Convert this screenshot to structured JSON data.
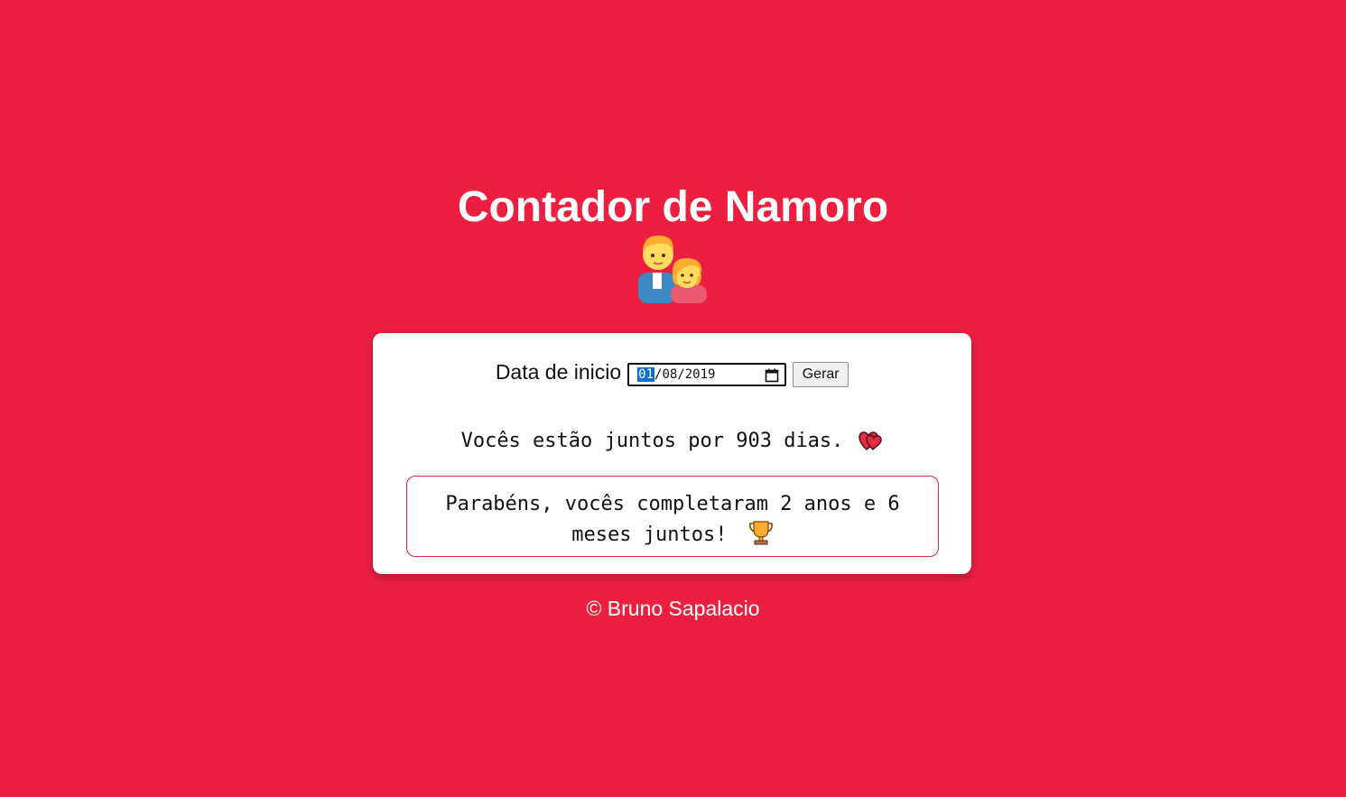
{
  "page": {
    "title": "Contador de Namoro",
    "title_icon": "couple-icon",
    "background_color": "#ec1f41"
  },
  "form": {
    "label": "Data de inicio",
    "date_day": "01",
    "date_rest": "/08/2019",
    "button_label": "Gerar"
  },
  "result": {
    "days_text": "Vocês estão juntos por 903 dias.",
    "days_icon": "heart-icon",
    "congrats_text": "Parabéns, vocês completaram 2 anos e 6 meses juntos!",
    "congrats_icon": "trophy-icon",
    "accent_color": "#e0284a"
  },
  "footer": {
    "text": "© Bruno Sapalacio"
  }
}
